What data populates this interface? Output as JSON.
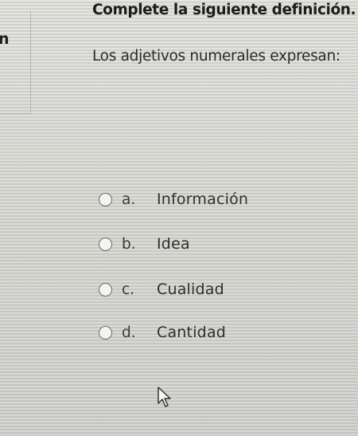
{
  "left_panel": {
    "text": "n"
  },
  "question": {
    "title": "Complete la siguiente definición.",
    "prompt": "Los adjetivos numerales expresan:"
  },
  "options": [
    {
      "letter": "a.",
      "text": "Información"
    },
    {
      "letter": "b.",
      "text": "Idea"
    },
    {
      "letter": "c.",
      "text": "Cualidad"
    },
    {
      "letter": "d.",
      "text": "Cantidad"
    }
  ],
  "cursor": {
    "icon": "mouse-pointer-icon"
  }
}
